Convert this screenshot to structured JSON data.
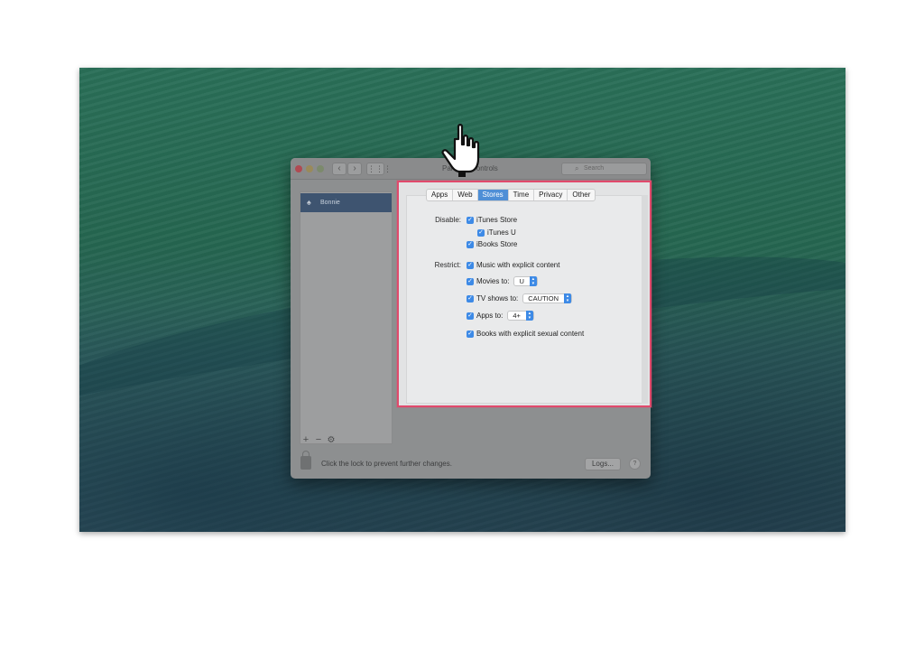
{
  "window": {
    "title": "Parental Controls",
    "search_placeholder": "Search",
    "nav_back": "‹",
    "nav_forward": "›",
    "nav_grid": "⋮⋮⋮"
  },
  "sidebar": {
    "user": "Bonnie",
    "add": "+",
    "remove": "−",
    "gear": "⚙"
  },
  "footer": {
    "lock_text": "Click the lock to prevent further changes.",
    "logs_label": "Logs...",
    "help": "?"
  },
  "tabs": [
    {
      "label": "Apps",
      "active": false
    },
    {
      "label": "Web",
      "active": false
    },
    {
      "label": "Stores",
      "active": true
    },
    {
      "label": "Time",
      "active": false
    },
    {
      "label": "Privacy",
      "active": false
    },
    {
      "label": "Other",
      "active": false
    }
  ],
  "stores": {
    "disable_label": "Disable:",
    "itunes_store": "iTunes Store",
    "itunes_u": "iTunes U",
    "ibooks_store": "iBooks Store",
    "restrict_label": "Restrict:",
    "music_explicit": "Music with explicit content",
    "movies_to": "Movies to:",
    "movies_value": "U",
    "tv_to": "TV shows to:",
    "tv_value": "CAUTION",
    "apps_to": "Apps to:",
    "apps_value": "4+",
    "books_explicit": "Books with explicit sexual content"
  },
  "colors": {
    "highlight": "#e04a6c",
    "accent": "#3d8ae6"
  }
}
